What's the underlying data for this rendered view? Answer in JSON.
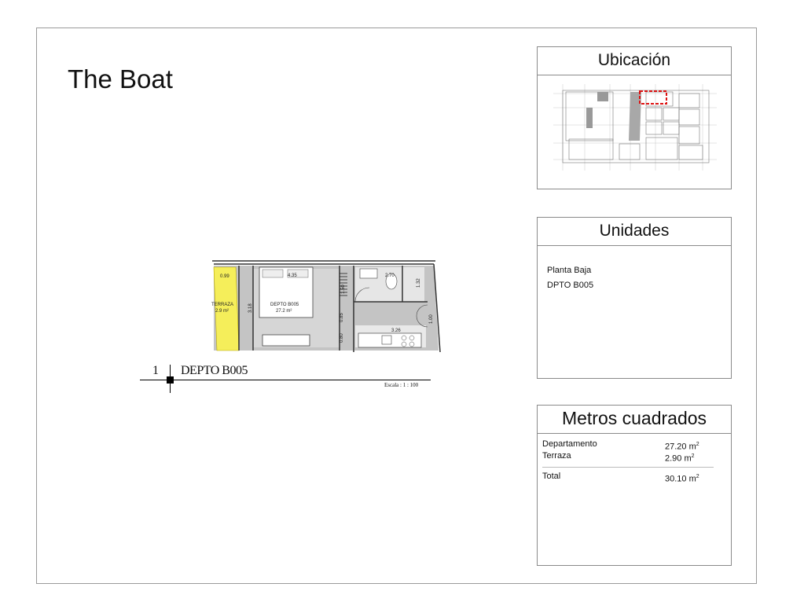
{
  "sheet": {
    "title": "The Boat"
  },
  "location_panel": {
    "title": "Ubicación"
  },
  "units_panel": {
    "title": "Unidades",
    "lines": [
      "Planta Baja",
      "DPTO B005"
    ]
  },
  "area_panel": {
    "title": "Metros cuadrados",
    "rows": [
      {
        "label": "Departamento",
        "value": "27.20 m",
        "unit_sup": "2"
      },
      {
        "label": "Terraza",
        "value": "2.90 m",
        "unit_sup": "2"
      }
    ],
    "total": {
      "label": "Total",
      "value": "30.10 m",
      "unit_sup": "2"
    }
  },
  "floor_plan": {
    "dims": {
      "terraza_width": "0.99",
      "room_width": "4.35",
      "bath_width": "2.70",
      "height": "3.18",
      "kitchen": "3.26",
      "d1": "1.50",
      "d2": "0.85",
      "d3": "0.80",
      "d4": "1.32",
      "d5": "1.00"
    },
    "terraza_label": "TERRAZA",
    "terraza_area": "2.9 m²",
    "depto_label": "DEPTO B005",
    "depto_area": "27.2 m²"
  },
  "caption": {
    "number": "1",
    "name": "DEPTO B005",
    "scale": "Escala : 1 : 100"
  },
  "colors": {
    "terraza_fill": "#f5ee5a",
    "highlight": "#dd1111",
    "gray": "#bdbdbd"
  }
}
